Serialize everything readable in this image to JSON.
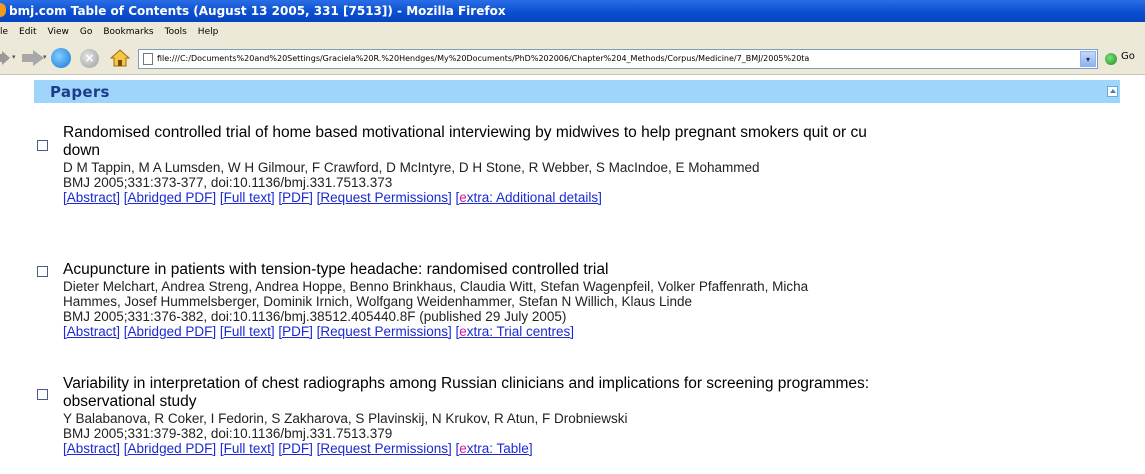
{
  "window": {
    "title": "bmj.com Table of Contents (August 13 2005, 331 [7513]) - Mozilla Firefox"
  },
  "menu": [
    "le",
    "Edit",
    "View",
    "Go",
    "Bookmarks",
    "Tools",
    "Help"
  ],
  "toolbar": {
    "back_icon": "back-arrow-icon",
    "forward_icon": "forward-arrow-icon",
    "url": "file:///C:/Documents%20and%20Settings/Graciela%20R.%20Hendges/My%20Documents/PhD%202006/Chapter%204_Methods/Corpus/Medicine/7_BMJ/2005%20ta",
    "go_label": "Go"
  },
  "section": {
    "title": "Papers"
  },
  "articles": [
    {
      "title_line1": "Randomised controlled trial of home based motivational interviewing by midwives to help pregnant smokers quit or cu",
      "title_line2": "down",
      "authors": "D M Tappin, M A Lumsden, W H Gilmour, F Crawford, D McIntyre, D H Stone, R Webber, S MacIndoe, E Mohammed",
      "authors2": "",
      "citation": "BMJ  2005;331:373-377, doi:10.1136/bmj.331.7513.373",
      "links": [
        "[Abstract]",
        "[Abridged PDF]",
        "[Full text]",
        "[PDF]",
        "[Request Permissions]"
      ],
      "extra": "xtra: Additional details]"
    },
    {
      "title_line1": "Acupuncture in patients with tension-type headache: randomised controlled trial",
      "authors": "Dieter Melchart, Andrea Streng, Andrea Hoppe, Benno Brinkhaus, Claudia Witt, Stefan Wagenpfeil, Volker Pfaffenrath, Micha",
      "authors2": "Hammes, Josef Hummelsberger, Dominik Irnich, Wolfgang Weidenhammer, Stefan N Willich, Klaus Linde",
      "citation": "BMJ  2005;331:376-382, doi:10.1136/bmj.38512.405440.8F (published 29 July 2005)",
      "links": [
        "[Abstract]",
        "[Abridged PDF]",
        "[Full text]",
        "[PDF]",
        "[Request Permissions]"
      ],
      "extra": "xtra: Trial centres]"
    },
    {
      "title_line1": "Variability in interpretation of chest radiographs among Russian clinicians and implications for screening programmes:",
      "title_line2": "observational study",
      "authors": "Y Balabanova, R Coker, I Fedorin, S Zakharova, S Plavinskij, N Krukov, R Atun, F Drobniewski",
      "citation": "BMJ  2005;331:379-382, doi:10.1136/bmj.331.7513.379",
      "links": [
        "[Abstract]",
        "[Abridged PDF]",
        "[Full text]",
        "[PDF]",
        "[Request Permissions]"
      ],
      "extra": "xtra: Table]"
    }
  ],
  "extra_prefix": "[",
  "extra_e": "e"
}
